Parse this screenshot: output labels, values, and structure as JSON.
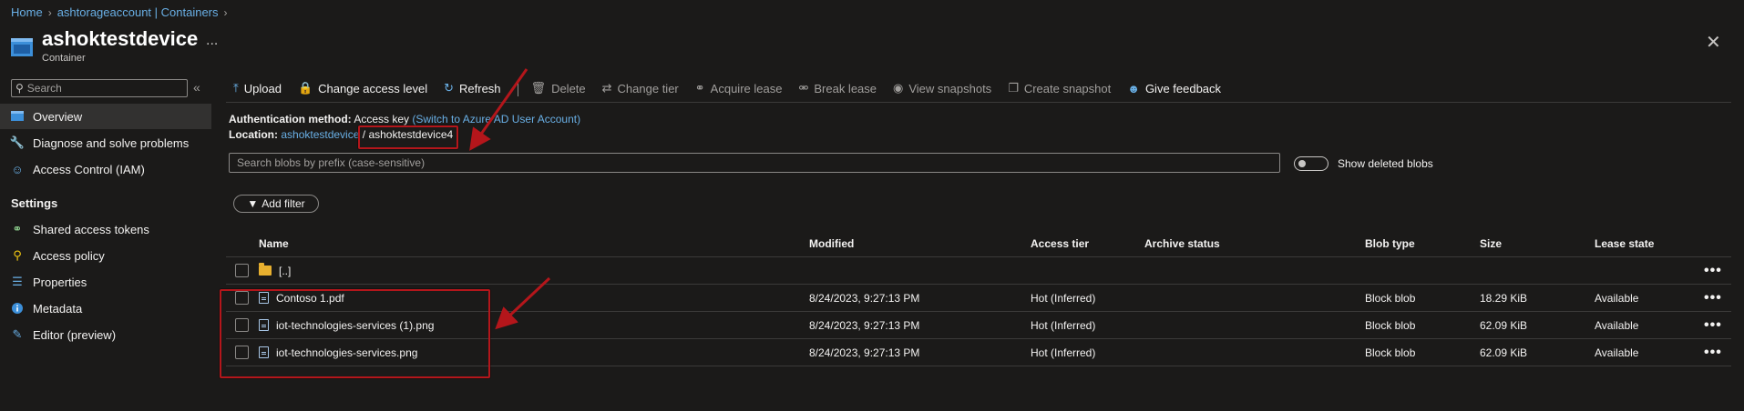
{
  "breadcrumb": {
    "items": [
      "Home",
      "ashtorageaccount | Containers"
    ]
  },
  "header": {
    "title": "ashoktestdevice",
    "subtitle": "Container",
    "more": "...",
    "close": "✕"
  },
  "sidebar": {
    "search_placeholder": "Search",
    "collapse": "«",
    "items": [
      {
        "label": "Overview",
        "icon": "overview-icon",
        "active": true
      },
      {
        "label": "Diagnose and solve problems",
        "icon": "wrench-icon"
      },
      {
        "label": "Access Control (IAM)",
        "icon": "people-icon"
      }
    ],
    "settings_heading": "Settings",
    "settings_items": [
      {
        "label": "Shared access tokens",
        "icon": "link-icon"
      },
      {
        "label": "Access policy",
        "icon": "key-icon"
      },
      {
        "label": "Properties",
        "icon": "sliders-icon"
      },
      {
        "label": "Metadata",
        "icon": "info-icon"
      },
      {
        "label": "Editor (preview)",
        "icon": "pencil-icon"
      }
    ]
  },
  "toolbar": {
    "upload": "Upload",
    "change_access_level": "Change access level",
    "refresh": "Refresh",
    "delete": "Delete",
    "change_tier": "Change tier",
    "acquire_lease": "Acquire lease",
    "break_lease": "Break lease",
    "view_snapshots": "View snapshots",
    "create_snapshot": "Create snapshot",
    "give_feedback": "Give feedback"
  },
  "info": {
    "auth_label": "Authentication method:",
    "auth_value": "Access key",
    "auth_link": "(Switch to Azure AD User Account)",
    "location_label": "Location:",
    "location_link": "ashoktestdevice",
    "location_sep": "/",
    "location_folder": "ashoktestdevice4"
  },
  "blob_search": {
    "placeholder": "Search blobs by prefix (case-sensitive)"
  },
  "show_deleted": {
    "label": "Show deleted blobs",
    "on": false
  },
  "add_filter": "Add filter",
  "table": {
    "columns": [
      "Name",
      "Modified",
      "Access tier",
      "Archive status",
      "Blob type",
      "Size",
      "Lease state"
    ],
    "parent_row": "[..]",
    "rows": [
      {
        "name": "Contoso 1.pdf",
        "modified": "8/24/2023, 9:27:13 PM",
        "tier": "Hot (Inferred)",
        "archive": "",
        "type": "Block blob",
        "size": "18.29 KiB",
        "lease": "Available"
      },
      {
        "name": "iot-technologies-services (1).png",
        "modified": "8/24/2023, 9:27:13 PM",
        "tier": "Hot (Inferred)",
        "archive": "",
        "type": "Block blob",
        "size": "62.09 KiB",
        "lease": "Available"
      },
      {
        "name": "iot-technologies-services.png",
        "modified": "8/24/2023, 9:27:13 PM",
        "tier": "Hot (Inferred)",
        "archive": "",
        "type": "Block blob",
        "size": "62.09 KiB",
        "lease": "Available"
      }
    ],
    "more": "•••"
  },
  "colors": {
    "background": "#1b1a19",
    "link": "#69afe5",
    "annotation": "#b4161b",
    "active_item": "#323130"
  }
}
